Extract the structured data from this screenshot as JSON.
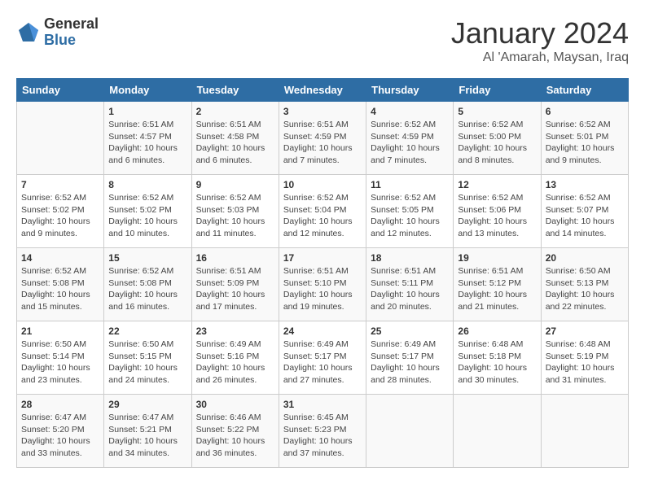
{
  "logo": {
    "general": "General",
    "blue": "Blue"
  },
  "title": "January 2024",
  "subtitle": "Al 'Amarah, Maysan, Iraq",
  "headers": [
    "Sunday",
    "Monday",
    "Tuesday",
    "Wednesday",
    "Thursday",
    "Friday",
    "Saturday"
  ],
  "weeks": [
    [
      {
        "day": "",
        "info": ""
      },
      {
        "day": "1",
        "info": "Sunrise: 6:51 AM\nSunset: 4:57 PM\nDaylight: 10 hours\nand 6 minutes."
      },
      {
        "day": "2",
        "info": "Sunrise: 6:51 AM\nSunset: 4:58 PM\nDaylight: 10 hours\nand 6 minutes."
      },
      {
        "day": "3",
        "info": "Sunrise: 6:51 AM\nSunset: 4:59 PM\nDaylight: 10 hours\nand 7 minutes."
      },
      {
        "day": "4",
        "info": "Sunrise: 6:52 AM\nSunset: 4:59 PM\nDaylight: 10 hours\nand 7 minutes."
      },
      {
        "day": "5",
        "info": "Sunrise: 6:52 AM\nSunset: 5:00 PM\nDaylight: 10 hours\nand 8 minutes."
      },
      {
        "day": "6",
        "info": "Sunrise: 6:52 AM\nSunset: 5:01 PM\nDaylight: 10 hours\nand 9 minutes."
      }
    ],
    [
      {
        "day": "7",
        "info": "Sunrise: 6:52 AM\nSunset: 5:02 PM\nDaylight: 10 hours\nand 9 minutes."
      },
      {
        "day": "8",
        "info": "Sunrise: 6:52 AM\nSunset: 5:02 PM\nDaylight: 10 hours\nand 10 minutes."
      },
      {
        "day": "9",
        "info": "Sunrise: 6:52 AM\nSunset: 5:03 PM\nDaylight: 10 hours\nand 11 minutes."
      },
      {
        "day": "10",
        "info": "Sunrise: 6:52 AM\nSunset: 5:04 PM\nDaylight: 10 hours\nand 12 minutes."
      },
      {
        "day": "11",
        "info": "Sunrise: 6:52 AM\nSunset: 5:05 PM\nDaylight: 10 hours\nand 12 minutes."
      },
      {
        "day": "12",
        "info": "Sunrise: 6:52 AM\nSunset: 5:06 PM\nDaylight: 10 hours\nand 13 minutes."
      },
      {
        "day": "13",
        "info": "Sunrise: 6:52 AM\nSunset: 5:07 PM\nDaylight: 10 hours\nand 14 minutes."
      }
    ],
    [
      {
        "day": "14",
        "info": "Sunrise: 6:52 AM\nSunset: 5:08 PM\nDaylight: 10 hours\nand 15 minutes."
      },
      {
        "day": "15",
        "info": "Sunrise: 6:52 AM\nSunset: 5:08 PM\nDaylight: 10 hours\nand 16 minutes."
      },
      {
        "day": "16",
        "info": "Sunrise: 6:51 AM\nSunset: 5:09 PM\nDaylight: 10 hours\nand 17 minutes."
      },
      {
        "day": "17",
        "info": "Sunrise: 6:51 AM\nSunset: 5:10 PM\nDaylight: 10 hours\nand 19 minutes."
      },
      {
        "day": "18",
        "info": "Sunrise: 6:51 AM\nSunset: 5:11 PM\nDaylight: 10 hours\nand 20 minutes."
      },
      {
        "day": "19",
        "info": "Sunrise: 6:51 AM\nSunset: 5:12 PM\nDaylight: 10 hours\nand 21 minutes."
      },
      {
        "day": "20",
        "info": "Sunrise: 6:50 AM\nSunset: 5:13 PM\nDaylight: 10 hours\nand 22 minutes."
      }
    ],
    [
      {
        "day": "21",
        "info": "Sunrise: 6:50 AM\nSunset: 5:14 PM\nDaylight: 10 hours\nand 23 minutes."
      },
      {
        "day": "22",
        "info": "Sunrise: 6:50 AM\nSunset: 5:15 PM\nDaylight: 10 hours\nand 24 minutes."
      },
      {
        "day": "23",
        "info": "Sunrise: 6:49 AM\nSunset: 5:16 PM\nDaylight: 10 hours\nand 26 minutes."
      },
      {
        "day": "24",
        "info": "Sunrise: 6:49 AM\nSunset: 5:17 PM\nDaylight: 10 hours\nand 27 minutes."
      },
      {
        "day": "25",
        "info": "Sunrise: 6:49 AM\nSunset: 5:17 PM\nDaylight: 10 hours\nand 28 minutes."
      },
      {
        "day": "26",
        "info": "Sunrise: 6:48 AM\nSunset: 5:18 PM\nDaylight: 10 hours\nand 30 minutes."
      },
      {
        "day": "27",
        "info": "Sunrise: 6:48 AM\nSunset: 5:19 PM\nDaylight: 10 hours\nand 31 minutes."
      }
    ],
    [
      {
        "day": "28",
        "info": "Sunrise: 6:47 AM\nSunset: 5:20 PM\nDaylight: 10 hours\nand 33 minutes."
      },
      {
        "day": "29",
        "info": "Sunrise: 6:47 AM\nSunset: 5:21 PM\nDaylight: 10 hours\nand 34 minutes."
      },
      {
        "day": "30",
        "info": "Sunrise: 6:46 AM\nSunset: 5:22 PM\nDaylight: 10 hours\nand 36 minutes."
      },
      {
        "day": "31",
        "info": "Sunrise: 6:45 AM\nSunset: 5:23 PM\nDaylight: 10 hours\nand 37 minutes."
      },
      {
        "day": "",
        "info": ""
      },
      {
        "day": "",
        "info": ""
      },
      {
        "day": "",
        "info": ""
      }
    ]
  ]
}
